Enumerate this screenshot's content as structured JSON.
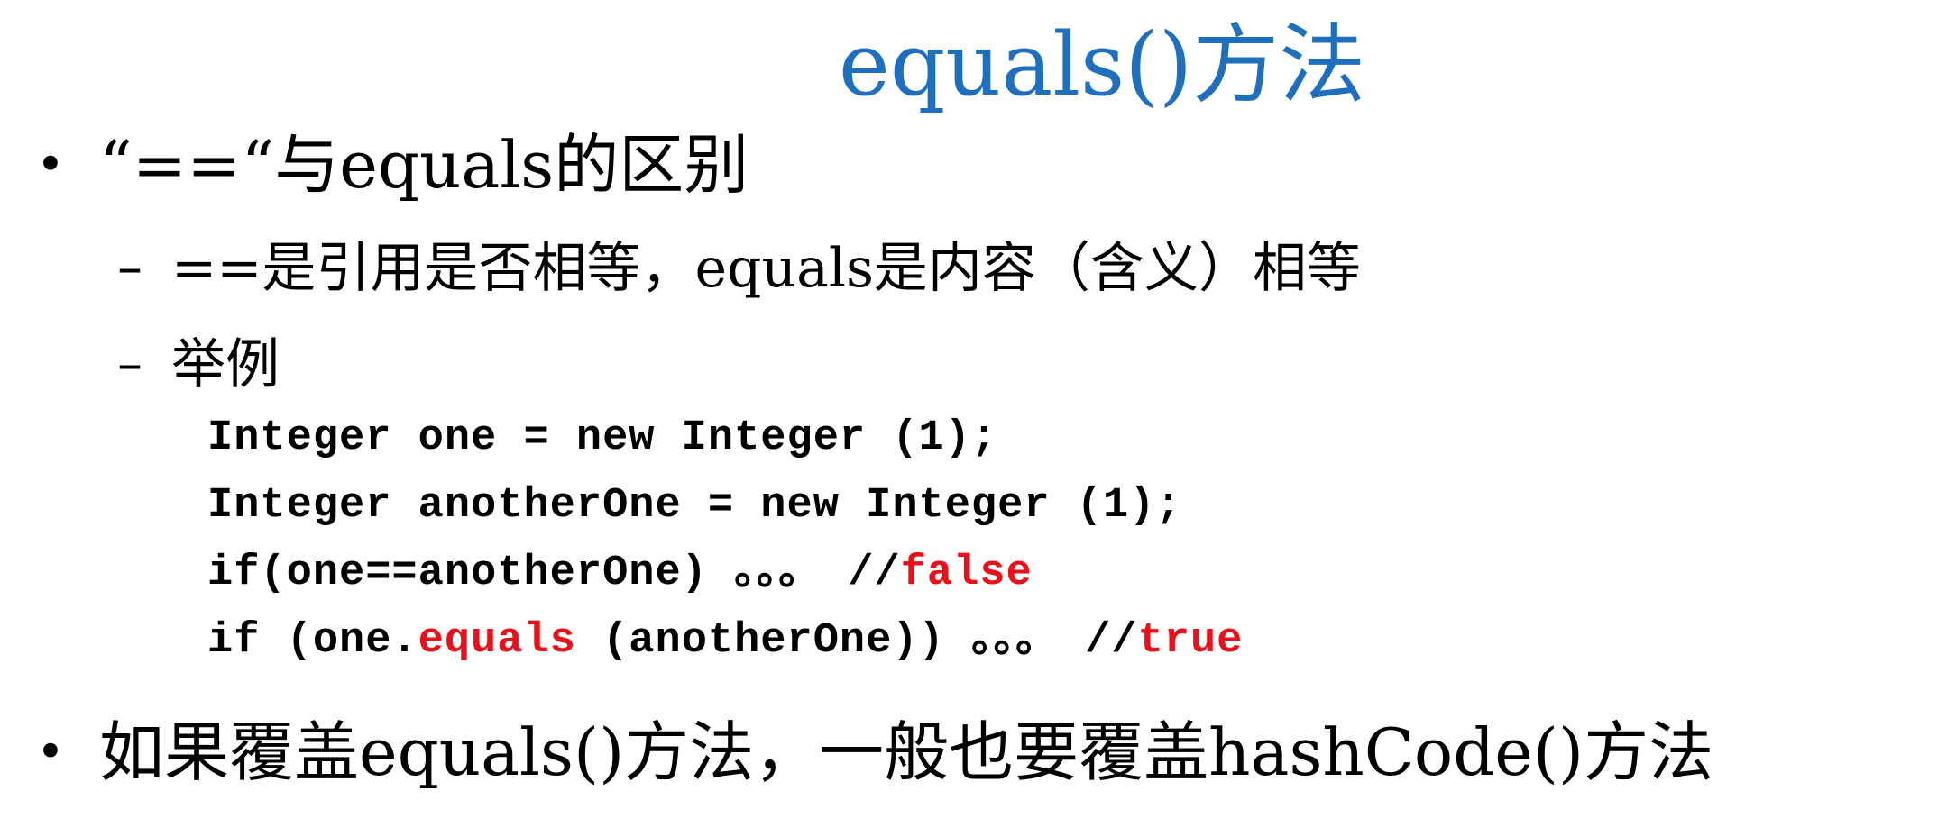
{
  "slide": {
    "title": "equals()方法",
    "bullets": [
      {
        "text": "“==“与equals的区别",
        "subitems": [
          {
            "text": "==是引用是否相等，equals是内容（含义）相等"
          },
          {
            "text": "举例"
          }
        ]
      },
      {
        "text": "如果覆盖equals()方法，一般也要覆盖hashCode()方法"
      }
    ],
    "code_lines": [
      {
        "a": "Integer one = new Integer (1);"
      },
      {
        "a": "Integer anotherOne = new Integer (1);"
      },
      {
        "a": "if(one==anotherOne) 。。。 //",
        "hl": "false"
      },
      {
        "a": "if (one.",
        "hl": "equals",
        "b": " (anotherOne)) 。。。 //",
        "hl2": "true"
      }
    ]
  },
  "colors": {
    "title": "#1f6fbf",
    "highlight": "#e8101a"
  }
}
